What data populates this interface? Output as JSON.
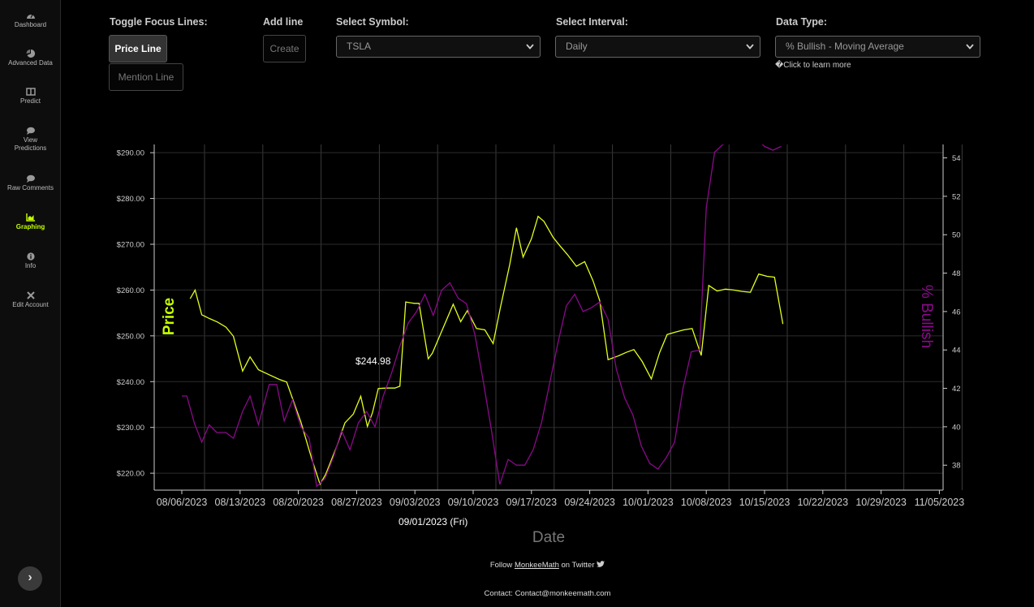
{
  "sidebar": {
    "items": [
      {
        "label": "Dashboard",
        "icon": "gauge-icon"
      },
      {
        "label": "Advanced Data",
        "icon": "pie-chart-icon"
      },
      {
        "label": "Predict",
        "icon": "columns-icon"
      },
      {
        "label": "View Predictions",
        "icon": "speech-bubble-icon"
      },
      {
        "label": "Raw Comments",
        "icon": "comment-icon"
      },
      {
        "label": "Graphing",
        "icon": "area-chart-icon",
        "active": true
      },
      {
        "label": "Info",
        "icon": "info-icon"
      },
      {
        "label": "Edit Account",
        "icon": "tools-icon"
      }
    ],
    "collapse_glyph": "›"
  },
  "controls": {
    "toggle_label": "Toggle Focus Lines:",
    "price_line": "Price Line",
    "mention_line": "Mention Line",
    "add_line_label": "Add line",
    "create": "Create",
    "symbol_label": "Select Symbol:",
    "symbol_value": "TSLA",
    "interval_label": "Select Interval:",
    "interval_value": "Daily",
    "datatype_label": "Data Type:",
    "datatype_value": "% Bullish - Moving Average",
    "learn_more": "�Click to learn more"
  },
  "colors": {
    "price": "#e4ff1a",
    "bullish": "#8a0a8a",
    "background": "#000000",
    "active_accent": "#c5ff00"
  },
  "chart_data": {
    "type": "line",
    "xlabel": "Date",
    "ylabel_left": "Price",
    "ylabel_right": "% Bullish",
    "x_ticks": [
      "08/06/2023",
      "08/13/2023",
      "08/20/2023",
      "08/27/2023",
      "09/03/2023",
      "09/10/2023",
      "09/17/2023",
      "09/24/2023",
      "10/01/2023",
      "10/08/2023",
      "10/15/2023",
      "10/22/2023",
      "10/29/2023",
      "11/05/2023"
    ],
    "y_left_ticks": [
      "$290.00",
      "$280.00",
      "$270.00",
      "$260.00",
      "$250.00",
      "$240.00",
      "$230.00",
      "$220.00"
    ],
    "y_left_values": [
      290,
      280,
      270,
      260,
      250,
      240,
      230,
      220
    ],
    "y_right_ticks": [
      "54",
      "52",
      "50",
      "48",
      "46",
      "44",
      "42",
      "40",
      "38"
    ],
    "y_right_values": [
      54,
      52,
      50,
      48,
      46,
      44,
      42,
      40,
      38
    ],
    "ylim_left": [
      216.3,
      291.8
    ],
    "ylim_right": [
      36.7,
      54.7
    ],
    "xlim_days": [
      0,
      95
    ],
    "grid": true,
    "tooltip": {
      "value": "$244.98",
      "date": "09/01/2023 (Fri)"
    },
    "series": [
      {
        "name": "Price",
        "axis": "left",
        "points": [
          [
            1.0,
            258.1
          ],
          [
            1.6,
            260.0
          ],
          [
            2.4,
            254.6
          ],
          [
            3.3,
            253.8
          ],
          [
            4.3,
            253.0
          ],
          [
            5.3,
            251.9
          ],
          [
            6.2,
            249.9
          ],
          [
            7.3,
            242.3
          ],
          [
            8.2,
            245.4
          ],
          [
            9.2,
            242.6
          ],
          [
            10.5,
            241.5
          ],
          [
            11.7,
            240.5
          ],
          [
            12.6,
            239.9
          ],
          [
            14.3,
            231.2
          ],
          [
            15.6,
            223.2
          ],
          [
            16.6,
            217.6
          ],
          [
            17.3,
            219.8
          ],
          [
            18.6,
            225.8
          ],
          [
            19.6,
            231.0
          ],
          [
            20.6,
            232.9
          ],
          [
            21.5,
            236.8
          ],
          [
            22.3,
            230.2
          ],
          [
            22.9,
            233.2
          ],
          [
            23.6,
            238.5
          ],
          [
            24.6,
            238.6
          ],
          [
            25.6,
            238.6
          ],
          [
            26.2,
            239.0
          ],
          [
            26.9,
            257.4
          ],
          [
            27.9,
            257.1
          ],
          [
            28.5,
            257.1
          ],
          [
            29.6,
            245.0
          ],
          [
            30.1,
            246.2
          ],
          [
            32.6,
            256.9
          ],
          [
            33.5,
            253.1
          ],
          [
            34.3,
            255.5
          ],
          [
            35.4,
            251.6
          ],
          [
            36.4,
            251.3
          ],
          [
            37.4,
            248.3
          ],
          [
            38.3,
            256.4
          ],
          [
            39.4,
            265.6
          ],
          [
            40.2,
            273.6
          ],
          [
            41.0,
            267.2
          ],
          [
            42.0,
            271.2
          ],
          [
            42.8,
            276.1
          ],
          [
            43.5,
            275.0
          ],
          [
            44.6,
            271.5
          ],
          [
            45.4,
            269.7
          ],
          [
            46.3,
            267.8
          ],
          [
            47.4,
            265.2
          ],
          [
            48.4,
            266.2
          ],
          [
            49.4,
            262.0
          ],
          [
            50.2,
            257.7
          ],
          [
            51.2,
            244.8
          ],
          [
            52.4,
            245.6
          ],
          [
            53.4,
            246.4
          ],
          [
            54.3,
            247.0
          ],
          [
            55.3,
            244.4
          ],
          [
            56.4,
            240.6
          ],
          [
            57.4,
            246.4
          ],
          [
            58.3,
            250.3
          ],
          [
            59.3,
            250.8
          ],
          [
            60.3,
            251.3
          ],
          [
            61.3,
            251.6
          ],
          [
            62.4,
            245.7
          ],
          [
            63.3,
            261.0
          ],
          [
            64.3,
            259.8
          ],
          [
            65.3,
            260.2
          ],
          [
            66.3,
            260.0
          ],
          [
            67.3,
            259.7
          ],
          [
            68.3,
            259.5
          ],
          [
            69.3,
            263.5
          ],
          [
            70.3,
            263.0
          ],
          [
            71.2,
            262.8
          ],
          [
            72.2,
            252.6
          ]
        ]
      },
      {
        "name": "% Bullish",
        "axis": "right",
        "points": [
          [
            0.0,
            41.6
          ],
          [
            0.6,
            41.6
          ],
          [
            1.5,
            40.2
          ],
          [
            2.4,
            39.2
          ],
          [
            3.3,
            40.1
          ],
          [
            4.2,
            39.7
          ],
          [
            5.3,
            39.7
          ],
          [
            6.2,
            39.4
          ],
          [
            7.3,
            40.8
          ],
          [
            8.2,
            41.6
          ],
          [
            9.2,
            40.1
          ],
          [
            10.5,
            42.2
          ],
          [
            11.4,
            42.2
          ],
          [
            12.3,
            40.3
          ],
          [
            13.3,
            41.4
          ],
          [
            14.3,
            40.0
          ],
          [
            15.3,
            39.4
          ],
          [
            16.2,
            36.9
          ],
          [
            17.2,
            37.3
          ],
          [
            18.2,
            38.4
          ],
          [
            19.2,
            39.8
          ],
          [
            20.2,
            38.8
          ],
          [
            21.2,
            40.2
          ],
          [
            22.2,
            40.8
          ],
          [
            23.2,
            40.0
          ],
          [
            24.2,
            41.6
          ],
          [
            25.2,
            42.8
          ],
          [
            26.2,
            44.2
          ],
          [
            27.2,
            45.4
          ],
          [
            28.2,
            46.0
          ],
          [
            29.2,
            46.9
          ],
          [
            30.2,
            45.8
          ],
          [
            31.2,
            47.1
          ],
          [
            32.2,
            47.5
          ],
          [
            33.2,
            46.7
          ],
          [
            34.2,
            46.4
          ],
          [
            35.2,
            44.8
          ],
          [
            36.2,
            42.4
          ],
          [
            37.2,
            39.8
          ],
          [
            38.2,
            37.0
          ],
          [
            39.2,
            38.3
          ],
          [
            40.2,
            38.0
          ],
          [
            41.2,
            38.0
          ],
          [
            42.2,
            38.8
          ],
          [
            43.2,
            40.2
          ],
          [
            44.2,
            42.3
          ],
          [
            45.2,
            44.4
          ],
          [
            46.2,
            46.3
          ],
          [
            47.2,
            46.9
          ],
          [
            48.2,
            46.0
          ],
          [
            49.2,
            46.2
          ],
          [
            50.2,
            46.5
          ],
          [
            51.2,
            45.6
          ],
          [
            52.2,
            43.0
          ],
          [
            53.2,
            41.5
          ],
          [
            54.2,
            40.6
          ],
          [
            55.2,
            39.0
          ],
          [
            56.2,
            38.1
          ],
          [
            57.2,
            37.8
          ],
          [
            58.2,
            38.4
          ],
          [
            59.2,
            39.2
          ],
          [
            60.2,
            42.0
          ],
          [
            61.2,
            43.9
          ],
          [
            62.2,
            44.0
          ],
          [
            63.0,
            51.4
          ],
          [
            64.0,
            54.3
          ],
          [
            65.0,
            54.7
          ],
          [
            66.0,
            54.9
          ],
          [
            67.0,
            55.1
          ],
          [
            68.0,
            55.3
          ],
          [
            69.0,
            55.0
          ],
          [
            70.0,
            54.6
          ],
          [
            71.0,
            54.4
          ],
          [
            72.0,
            54.6
          ]
        ]
      }
    ]
  },
  "footer": {
    "follow_prefix": "Follow ",
    "handle": "MonkeeMath",
    "follow_suffix": " on Twitter",
    "twitter_icon": "twitter-bird-icon",
    "contact": "Contact: Contact@monkeemath.com"
  }
}
